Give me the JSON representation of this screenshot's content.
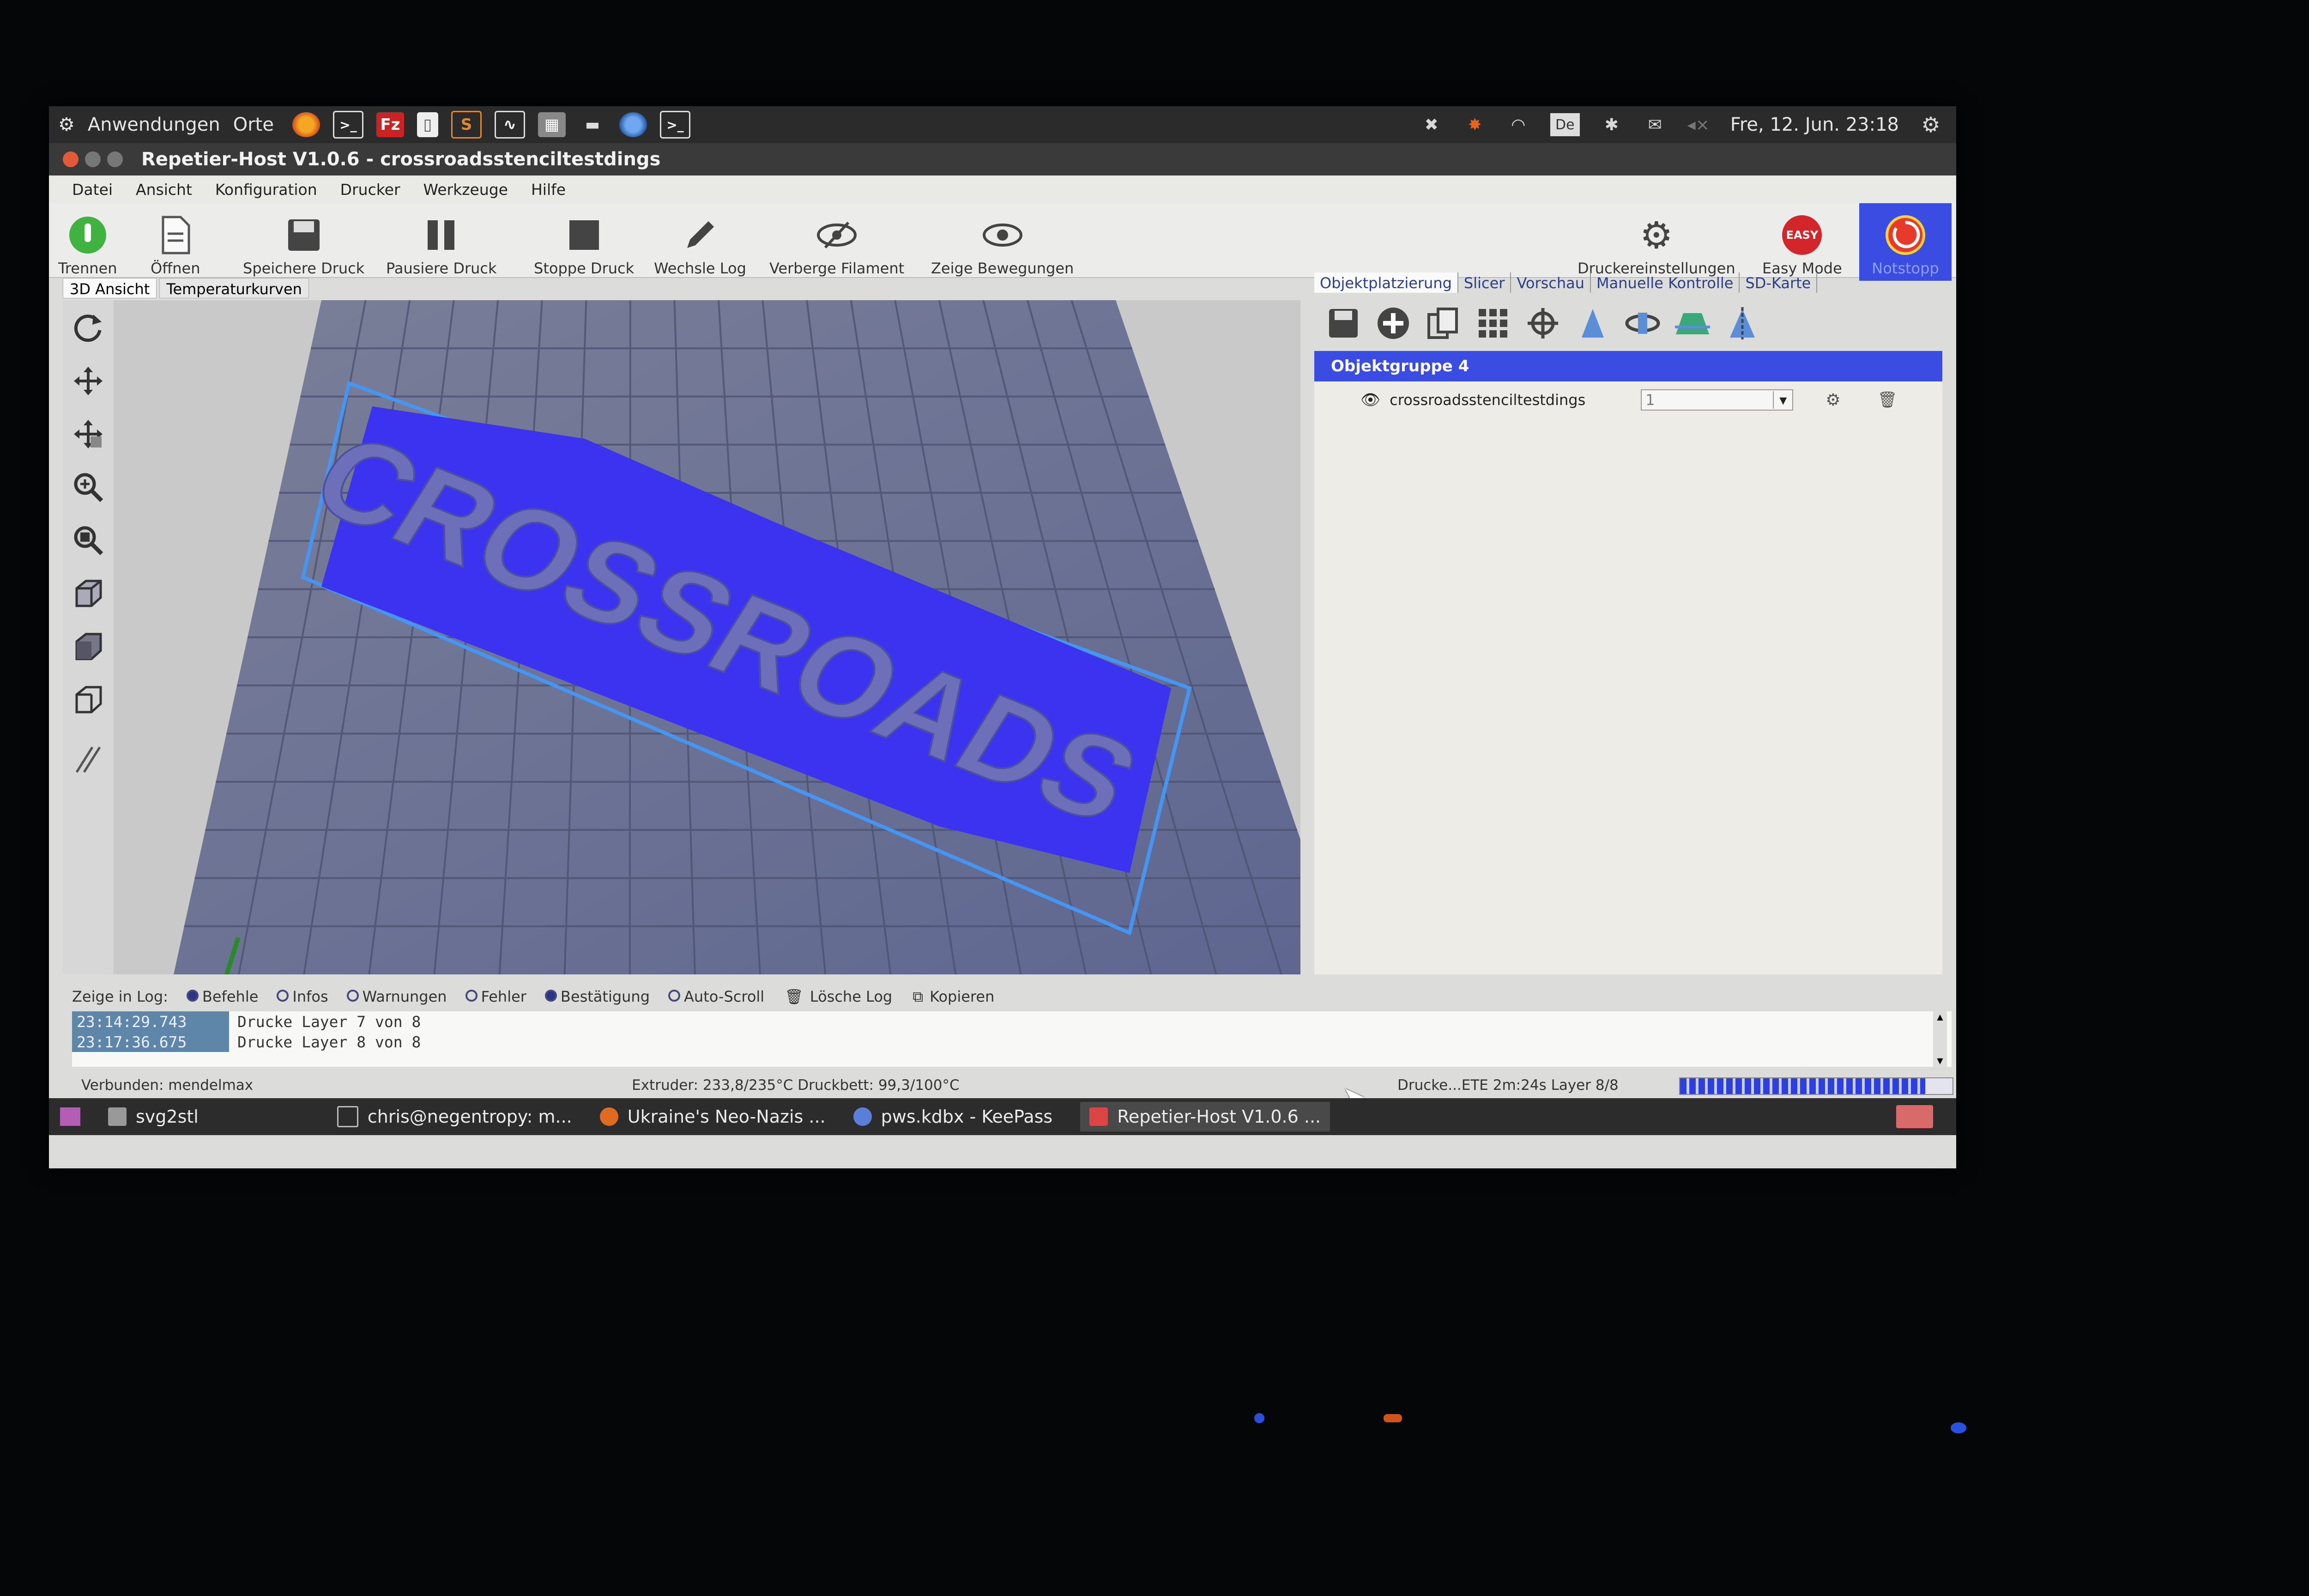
{
  "top_panel": {
    "apps_label": "Anwendungen",
    "places_label": "Orte",
    "launchers": [
      "firefox-icon",
      "terminal-icon",
      "filezilla-icon",
      "file-icon",
      "slic3r-icon",
      "system-monitor-icon",
      "calculator-icon",
      "printer-icon",
      "thunderbird-icon",
      "terminal2-icon"
    ],
    "datetime": "Fre, 12. Jun. 23:18",
    "tray_de": "De"
  },
  "window": {
    "title": "Repetier-Host V1.0.6 - crossroadsstenciltestdings"
  },
  "menubar": [
    "Datei",
    "Ansicht",
    "Konfiguration",
    "Drucker",
    "Werkzeuge",
    "Hilfe"
  ],
  "toolbar": {
    "disconnect": "Trennen",
    "open": "Öffnen",
    "save_job": "Speichere Druck",
    "pause_job": "Pausiere Druck",
    "stop_job": "Stoppe Druck",
    "toggle_log": "Wechsle Log",
    "hide_filament": "Verberge Filament",
    "show_travel": "Zeige Bewegungen",
    "printer_settings": "Druckereinstellungen",
    "easy_mode": "Easy Mode",
    "easy_badge": "EASY",
    "emergency_stop": "Notstopp"
  },
  "view_tabs": [
    "3D Ansicht",
    "Temperaturkurven"
  ],
  "model_text": "CROSSROADS",
  "right_tabs": [
    "Objektplatzierung",
    "Slicer",
    "Vorschau",
    "Manuelle Kontrolle",
    "SD-Karte"
  ],
  "object_panel": {
    "group_label": "Objektgruppe 4",
    "object_name": "crossroadsstenciltestdings",
    "copies_value": "1"
  },
  "log_bar": {
    "show_label": "Zeige in Log:",
    "options": [
      {
        "label": "Befehle",
        "checked": true
      },
      {
        "label": "Infos",
        "checked": false
      },
      {
        "label": "Warnungen",
        "checked": false
      },
      {
        "label": "Fehler",
        "checked": false
      },
      {
        "label": "Bestätigung",
        "checked": true
      },
      {
        "label": "Auto-Scroll",
        "checked": false
      }
    ],
    "clear_log": "Lösche Log",
    "copy": "Kopieren"
  },
  "log": [
    {
      "time": "23:14:29.743",
      "msg": "Drucke Layer 7 von 8"
    },
    {
      "time": "23:17:36.675",
      "msg": "Drucke Layer 8 von 8"
    }
  ],
  "status": {
    "connection": "Verbunden: mendelmax",
    "temps": "Extruder: 233,8/235°C Druckbett: 99,3/100°C",
    "print_status": "Drucke...ETE 2m:24s Layer 8/8",
    "progress": 0.9
  },
  "taskbar": [
    {
      "label": "svg2stl",
      "active": false
    },
    {
      "label": "chris@negentropy: m...",
      "active": false
    },
    {
      "label": "Ukraine's Neo-Nazis ...",
      "active": false
    },
    {
      "label": "pws.kdbx - KeePass",
      "active": false
    },
    {
      "label": "Repetier-Host V1.0.6 ...",
      "active": true
    }
  ],
  "colors": {
    "model_blue": "#3b33f0",
    "selection_blue": "#3d8cf0",
    "bed_gray": "#6b7290",
    "accent": "#3b4ce3"
  }
}
